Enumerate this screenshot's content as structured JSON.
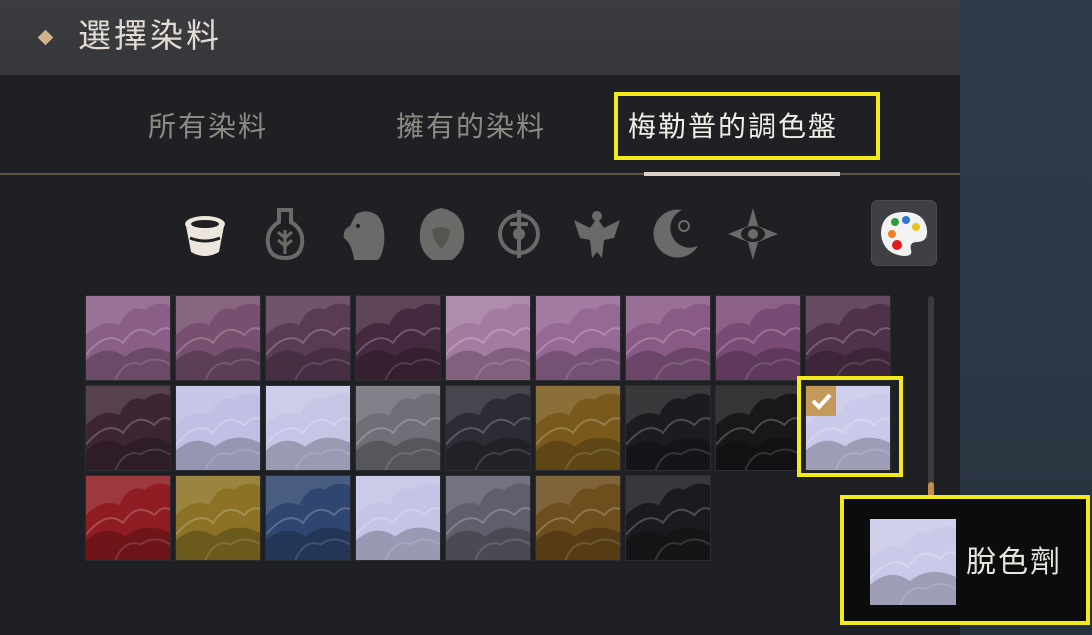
{
  "header": {
    "title": "選擇染料"
  },
  "tabs": [
    {
      "label": "所有染料",
      "active": false
    },
    {
      "label": "擁有的染料",
      "active": false
    },
    {
      "label": "梅勒普的調色盤",
      "active": true
    }
  ],
  "filters": [
    {
      "icon": "bucket-icon",
      "active": true
    },
    {
      "icon": "flask-wheat-icon",
      "active": false
    },
    {
      "icon": "horse-head-icon",
      "active": false
    },
    {
      "icon": "lion-head-icon",
      "active": false
    },
    {
      "icon": "sword-emblem-icon",
      "active": false
    },
    {
      "icon": "eagle-icon",
      "active": false
    },
    {
      "icon": "crescent-moon-icon",
      "active": false
    },
    {
      "icon": "eye-star-icon",
      "active": false
    }
  ],
  "palette_button": {
    "icon": "palette-icon"
  },
  "swatches": [
    [
      {
        "color": "#8a5f86"
      },
      {
        "color": "#77506f"
      },
      {
        "color": "#5a3b56"
      },
      {
        "color": "#45293f"
      },
      {
        "color": "#a47ba0"
      },
      {
        "color": "#966896"
      },
      {
        "color": "#8a5a86"
      },
      {
        "color": "#7a4a76"
      },
      {
        "color": "#4f3149"
      }
    ],
    [
      {
        "color": "#3c2633"
      },
      {
        "color": "#bfc0e4"
      },
      {
        "color": "#c5c6e6"
      },
      {
        "color": "#6f6f78"
      },
      {
        "color": "#2b2c34"
      },
      {
        "color": "#7a5a1c"
      },
      {
        "color": "#1c1c20"
      },
      {
        "color": "#18181b"
      },
      {
        "color": "#c9c9ea",
        "selected": true
      }
    ],
    [
      {
        "color": "#8e1c22"
      },
      {
        "color": "#8b7224"
      },
      {
        "color": "#2f4670"
      },
      {
        "color": "#c3c4e6"
      },
      {
        "color": "#5f5f6c"
      },
      {
        "color": "#6e4e1c"
      },
      {
        "color": "#1b1b1f"
      },
      {
        "empty": true
      },
      {
        "empty": true
      }
    ]
  ],
  "tooltip": {
    "label": "脫色劑",
    "color": "#c9c9ea"
  },
  "colors": {
    "highlight": "#f2ea1a",
    "accent": "#c49a58"
  }
}
